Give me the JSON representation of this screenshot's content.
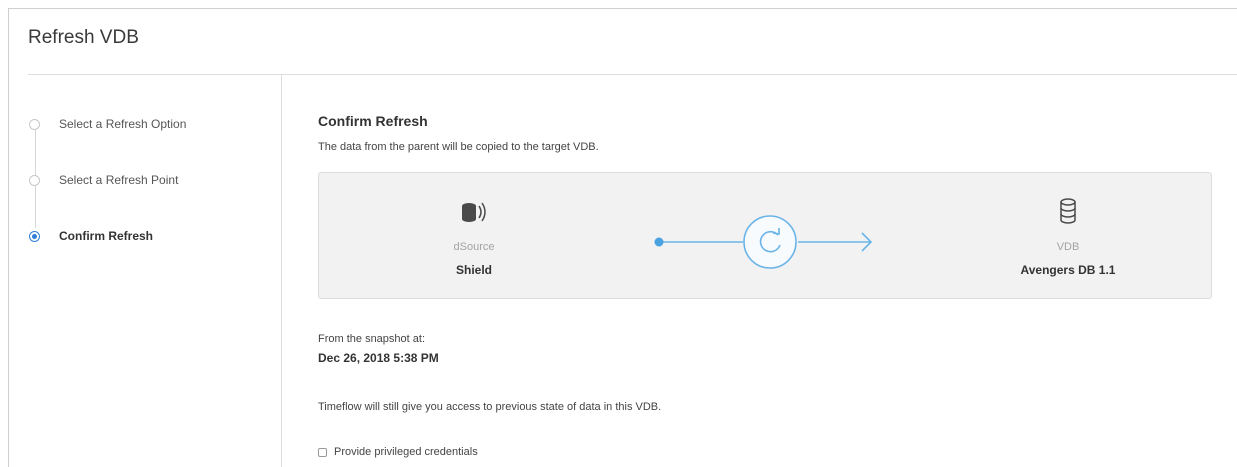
{
  "dialog": {
    "title": "Refresh VDB"
  },
  "steps": [
    {
      "label": "Select a Refresh Option",
      "state": "inactive"
    },
    {
      "label": "Select a Refresh Point",
      "state": "inactive"
    },
    {
      "label": "Confirm Refresh",
      "state": "active"
    }
  ],
  "main": {
    "title": "Confirm Refresh",
    "description": "The data from the parent will be copied to the target VDB.",
    "flow": {
      "source": {
        "type": "dSource",
        "name": "Shield",
        "icon": "dsource-icon"
      },
      "action_icon": "refresh-icon",
      "target": {
        "type": "VDB",
        "name": "Avengers DB 1.1",
        "icon": "database-icon"
      }
    },
    "snapshot_label": "From the snapshot at:",
    "snapshot_date": "Dec 26, 2018 5:38 PM",
    "timeflow_note": "Timeflow will still give you access to previous state of data in this VDB.",
    "credentials_label": "Provide privileged credentials",
    "credentials_checked": false
  },
  "colors": {
    "accent": "#2f7fd8",
    "flow_line": "#6ab4e8",
    "box_bg": "#f2f2f2"
  }
}
